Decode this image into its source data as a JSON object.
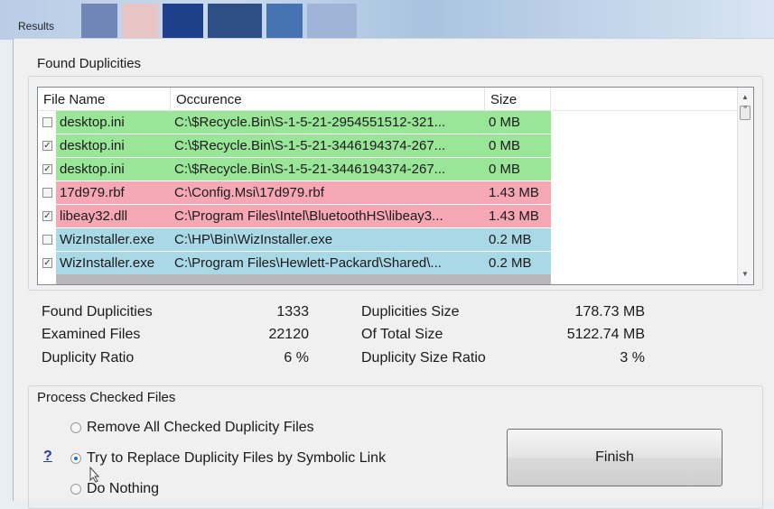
{
  "window": {
    "title": "Results"
  },
  "found_group": {
    "title": "Found Duplicities"
  },
  "table": {
    "columns": [
      "File Name",
      "Occurence",
      "Size"
    ],
    "rows": [
      {
        "checked": false,
        "name": "desktop.ini",
        "occurence": "C:\\$Recycle.Bin\\S-1-5-21-2954551512-321...",
        "size": "0 MB",
        "color": "#99e699"
      },
      {
        "checked": true,
        "name": "desktop.ini",
        "occurence": "C:\\$Recycle.Bin\\S-1-5-21-3446194374-267...",
        "size": "0 MB",
        "color": "#99e699"
      },
      {
        "checked": true,
        "name": "desktop.ini",
        "occurence": "C:\\$Recycle.Bin\\S-1-5-21-3446194374-267...",
        "size": "0 MB",
        "color": "#99e699"
      },
      {
        "checked": false,
        "name": "17d979.rbf",
        "occurence": "C:\\Config.Msi\\17d979.rbf",
        "size": "1.43 MB",
        "color": "#f5a7b4"
      },
      {
        "checked": true,
        "name": "libeay32.dll",
        "occurence": "C:\\Program Files\\Intel\\BluetoothHS\\libeay3...",
        "size": "1.43 MB",
        "color": "#f5a7b4"
      },
      {
        "checked": false,
        "name": "WizInstaller.exe",
        "occurence": "C:\\HP\\Bin\\WizInstaller.exe",
        "size": "0.2 MB",
        "color": "#a9d8e6"
      },
      {
        "checked": true,
        "name": "WizInstaller.exe",
        "occurence": "C:\\Program Files\\Hewlett-Packard\\Shared\\...",
        "size": "0.2 MB",
        "color": "#a9d8e6"
      }
    ]
  },
  "stats": {
    "found_duplicities": {
      "label": "Found Duplicities",
      "value": "1333"
    },
    "examined_files": {
      "label": "Examined Files",
      "value": "22120"
    },
    "duplicity_ratio": {
      "label": "Duplicity Ratio",
      "value": "6 %"
    },
    "duplicities_size": {
      "label": "Duplicities Size",
      "value": "178.73 MB"
    },
    "of_total_size": {
      "label": "Of Total Size",
      "value": "5122.74 MB"
    },
    "duplicity_size_ratio": {
      "label": "Duplicity Size Ratio",
      "value": "3 %"
    }
  },
  "process_group": {
    "title": "Process Checked Files",
    "options": [
      {
        "label": "Remove All Checked Duplicity Files",
        "selected": false
      },
      {
        "label": "Try to Replace Duplicity Files by Symbolic Link",
        "selected": true
      },
      {
        "label": "Do Nothing",
        "selected": false
      }
    ],
    "help_label": "?"
  },
  "finish_label": "Finish",
  "colors": {
    "green": "#99e699",
    "pink": "#f5a7b4",
    "blue": "#a9d8e6"
  }
}
